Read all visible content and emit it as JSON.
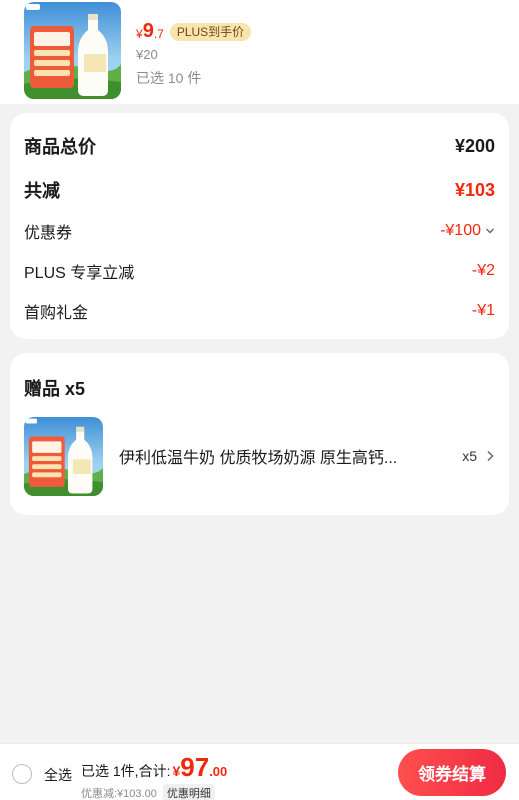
{
  "product": {
    "currency": "¥",
    "price_int": "9",
    "price_dec": ".7",
    "plus_tag": "PLUS到手价",
    "original_price": "¥20",
    "selected_count": "已选 10 件"
  },
  "summary": {
    "rows": [
      {
        "label": "商品总价",
        "value": "¥200"
      },
      {
        "label": "共减",
        "value": "¥103"
      },
      {
        "label": "优惠券",
        "value": "-¥100"
      },
      {
        "label": "PLUS 专享立减",
        "value": "-¥2"
      },
      {
        "label": "首购礼金",
        "value": "-¥1"
      }
    ]
  },
  "gifts": {
    "title": "赠品 x5",
    "item": {
      "name": "伊利低温牛奶 优质牧场奶源 原生高钙...",
      "qty": "x5"
    }
  },
  "bottom": {
    "select_all": "全选",
    "total_label": "已选 1件,合计:",
    "currency": "¥",
    "total_int": "97",
    "total_dec": ".00",
    "discount_text": "优惠减:¥103.00",
    "discount_detail": "优惠明细",
    "checkout": "领券结算"
  },
  "colors": {
    "accent_red": "#f2270c",
    "plus_gold": "#fbe3b0",
    "background": "#f2f2f2"
  },
  "icons": [
    "chevron-down-icon",
    "chevron-right-icon",
    "radio-unchecked-icon"
  ]
}
